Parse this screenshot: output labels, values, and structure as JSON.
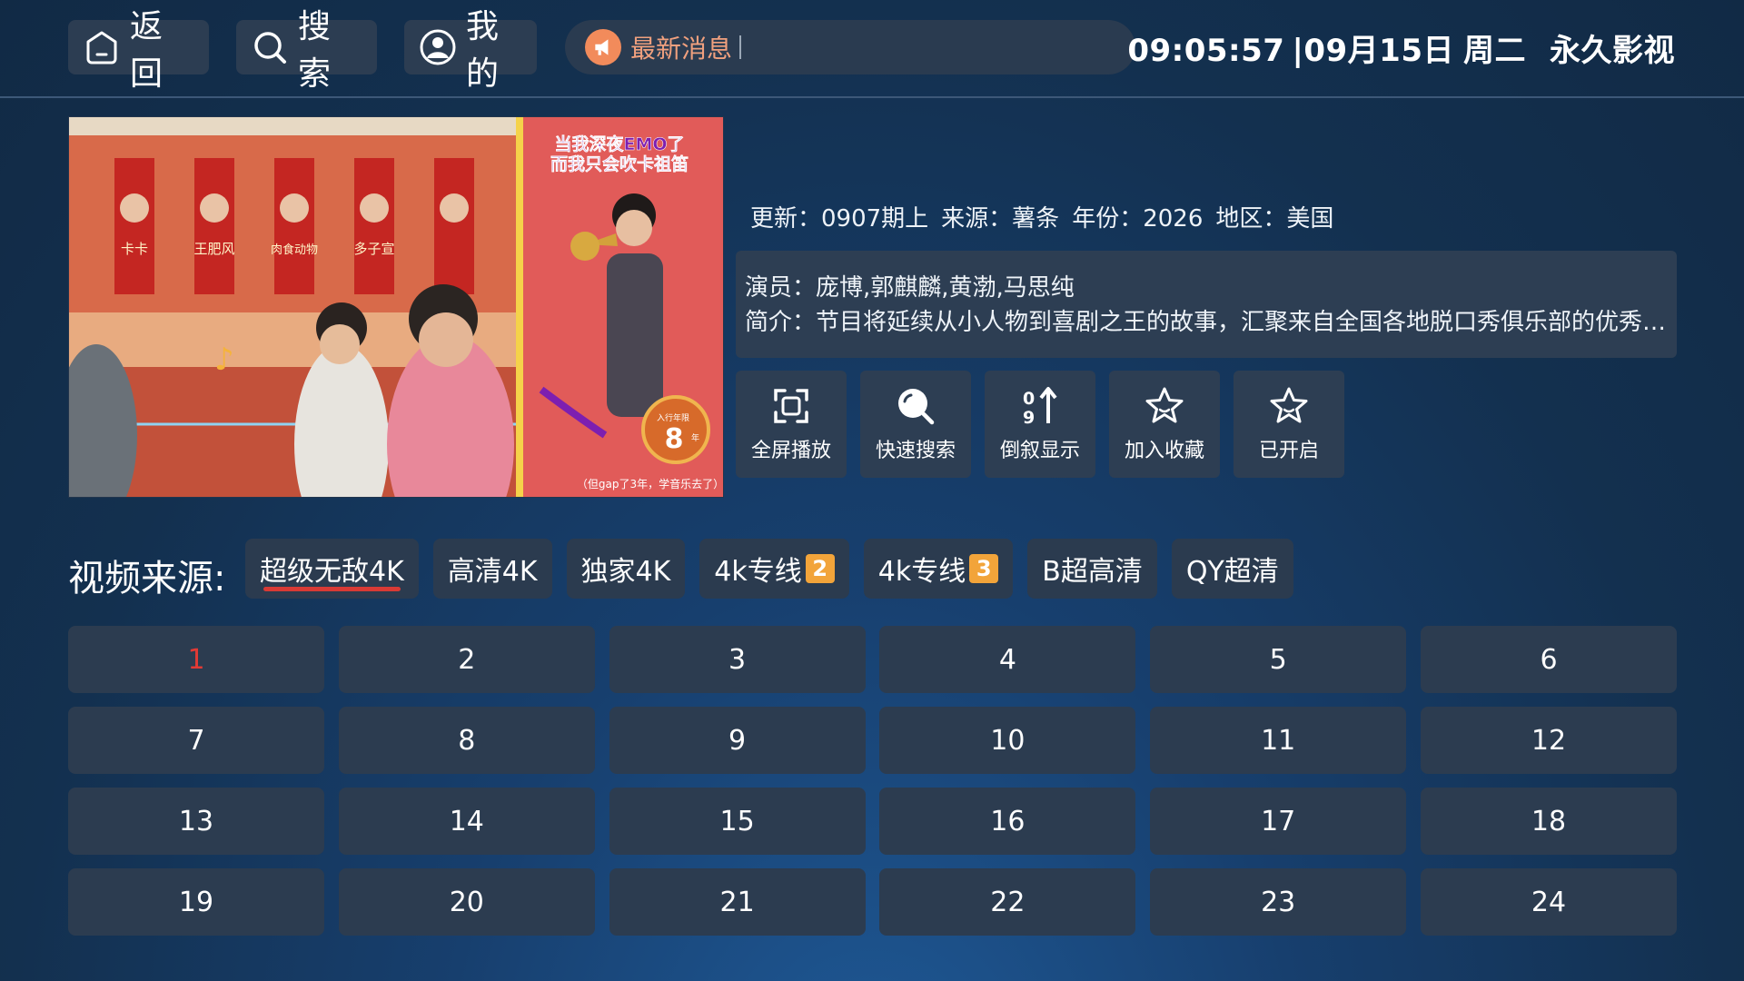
{
  "header": {
    "back_label": "返回",
    "search_label": "搜索",
    "mine_label": "我的",
    "news_label": "最新消息",
    "time": "09:05:57",
    "date": "|09月15日",
    "weekday": "周二",
    "app_name": "永久影视"
  },
  "info": {
    "update": "更新：0907期上",
    "source": "来源：薯条",
    "year": "年份：2026",
    "region": "地区：美国",
    "actors": "演员：庞博,郭麒麟,黄渤,马思纯",
    "synopsis": "简介：节目将延续从小人物到喜剧之王的故事，汇聚来自全国各地脱口秀俱乐部的优秀脱口秀演员"
  },
  "poster": {
    "headline_1": "当我深夜EMO了",
    "headline_2": "而我只会吹卡祖笛",
    "names": [
      "卡卡",
      "王肥风",
      "肉食动物",
      "多子宣"
    ],
    "badge_top": "入行年限",
    "badge_number": "8",
    "badge_unit": "年",
    "caption": "（但gap了3年，学音乐去了）"
  },
  "actions": [
    {
      "label": "全屏播放",
      "icon": "fullscreen-icon"
    },
    {
      "label": "快速搜索",
      "icon": "search-icon"
    },
    {
      "label": "倒叙显示",
      "icon": "sort-icon"
    },
    {
      "label": "加入收藏",
      "icon": "star-icon"
    },
    {
      "label": "已开启",
      "icon": "star-icon"
    }
  ],
  "sources": {
    "title": "视频来源:",
    "tabs": [
      {
        "label": "超级无敌4K",
        "badge": ""
      },
      {
        "label": "高清4K",
        "badge": ""
      },
      {
        "label": "独家4K",
        "badge": ""
      },
      {
        "label": "4k专线",
        "badge": "2"
      },
      {
        "label": "4k专线",
        "badge": "3"
      },
      {
        "label": "B超高清",
        "badge": ""
      },
      {
        "label": "QY超清",
        "badge": ""
      }
    ],
    "active_index": 0
  },
  "episodes": [
    "1",
    "2",
    "3",
    "4",
    "5",
    "6",
    "7",
    "8",
    "9",
    "10",
    "11",
    "12",
    "13",
    "14",
    "15",
    "16",
    "17",
    "18",
    "19",
    "20",
    "21",
    "22",
    "23",
    "24"
  ],
  "current_episode_index": 0,
  "colors": {
    "accent": "#e23a35",
    "badge": "#f2a43a",
    "news": "#f28b5b"
  }
}
